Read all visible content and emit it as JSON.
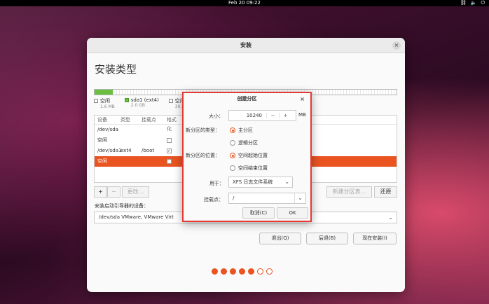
{
  "topbar": {
    "clock": "Feb 20  09:22",
    "icons": [
      "network-icon",
      "volume-icon",
      "power-icon"
    ]
  },
  "window": {
    "title": "安装",
    "close": "×"
  },
  "page": {
    "title": "安装类型"
  },
  "disk_usage_fraction": 0.06,
  "legend": [
    {
      "label": "空闲",
      "size": "1.6 MB",
      "color": "#ffffff"
    },
    {
      "label": "sda1 (ext4)",
      "size": "2.0 GB",
      "color": "#6abf40"
    },
    {
      "label": "空闲",
      "size": "30.2",
      "color": "#ffffff"
    }
  ],
  "table": {
    "headers": [
      "设备",
      "类型",
      "挂载点",
      "格式化"
    ],
    "rows": [
      {
        "device": "/dev/sda",
        "type": "",
        "mount": "",
        "format": "none"
      },
      {
        "device": "空闲",
        "type": "",
        "mount": "",
        "format": "unchecked"
      },
      {
        "device": "/dev/sda1",
        "type": "ext4",
        "mount": "/boot",
        "format": "checked"
      },
      {
        "device": "空闲",
        "type": "",
        "mount": "",
        "format": "unchecked",
        "selected": true
      }
    ]
  },
  "toolbar": {
    "add": "+",
    "remove": "−",
    "change": "更改...",
    "new_table": "新建分区表...",
    "revert": "还原"
  },
  "boot": {
    "label": "安装启动引导器的设备：",
    "value": "/dev/sda   VMware, VMware Virt"
  },
  "buttons": {
    "quit": "退出(Q)",
    "back": "后退(B)",
    "install": "现在安装(I)"
  },
  "progress_dots": {
    "total": 7,
    "filled": 5
  },
  "dialog": {
    "title": "创建分区",
    "close": "×",
    "size_label": "大小：",
    "size_value": "10240",
    "minus": "−",
    "plus": "+",
    "unit": "MB",
    "type_label": "新分区的类型：",
    "type_options": [
      "主分区",
      "逻辑分区"
    ],
    "type_selected": 0,
    "location_label": "新分区的位置：",
    "location_options": [
      "空间起始位置",
      "空间结束位置"
    ],
    "location_selected": 0,
    "use_label": "用于：",
    "use_value": "XFS 日志文件系统",
    "mount_label": "挂载点：",
    "mount_value": "/",
    "cancel": "取消(C)",
    "ok": "OK"
  },
  "colors": {
    "accent": "#e95420",
    "used": "#6abf40",
    "highlight_border": "#e53935"
  }
}
